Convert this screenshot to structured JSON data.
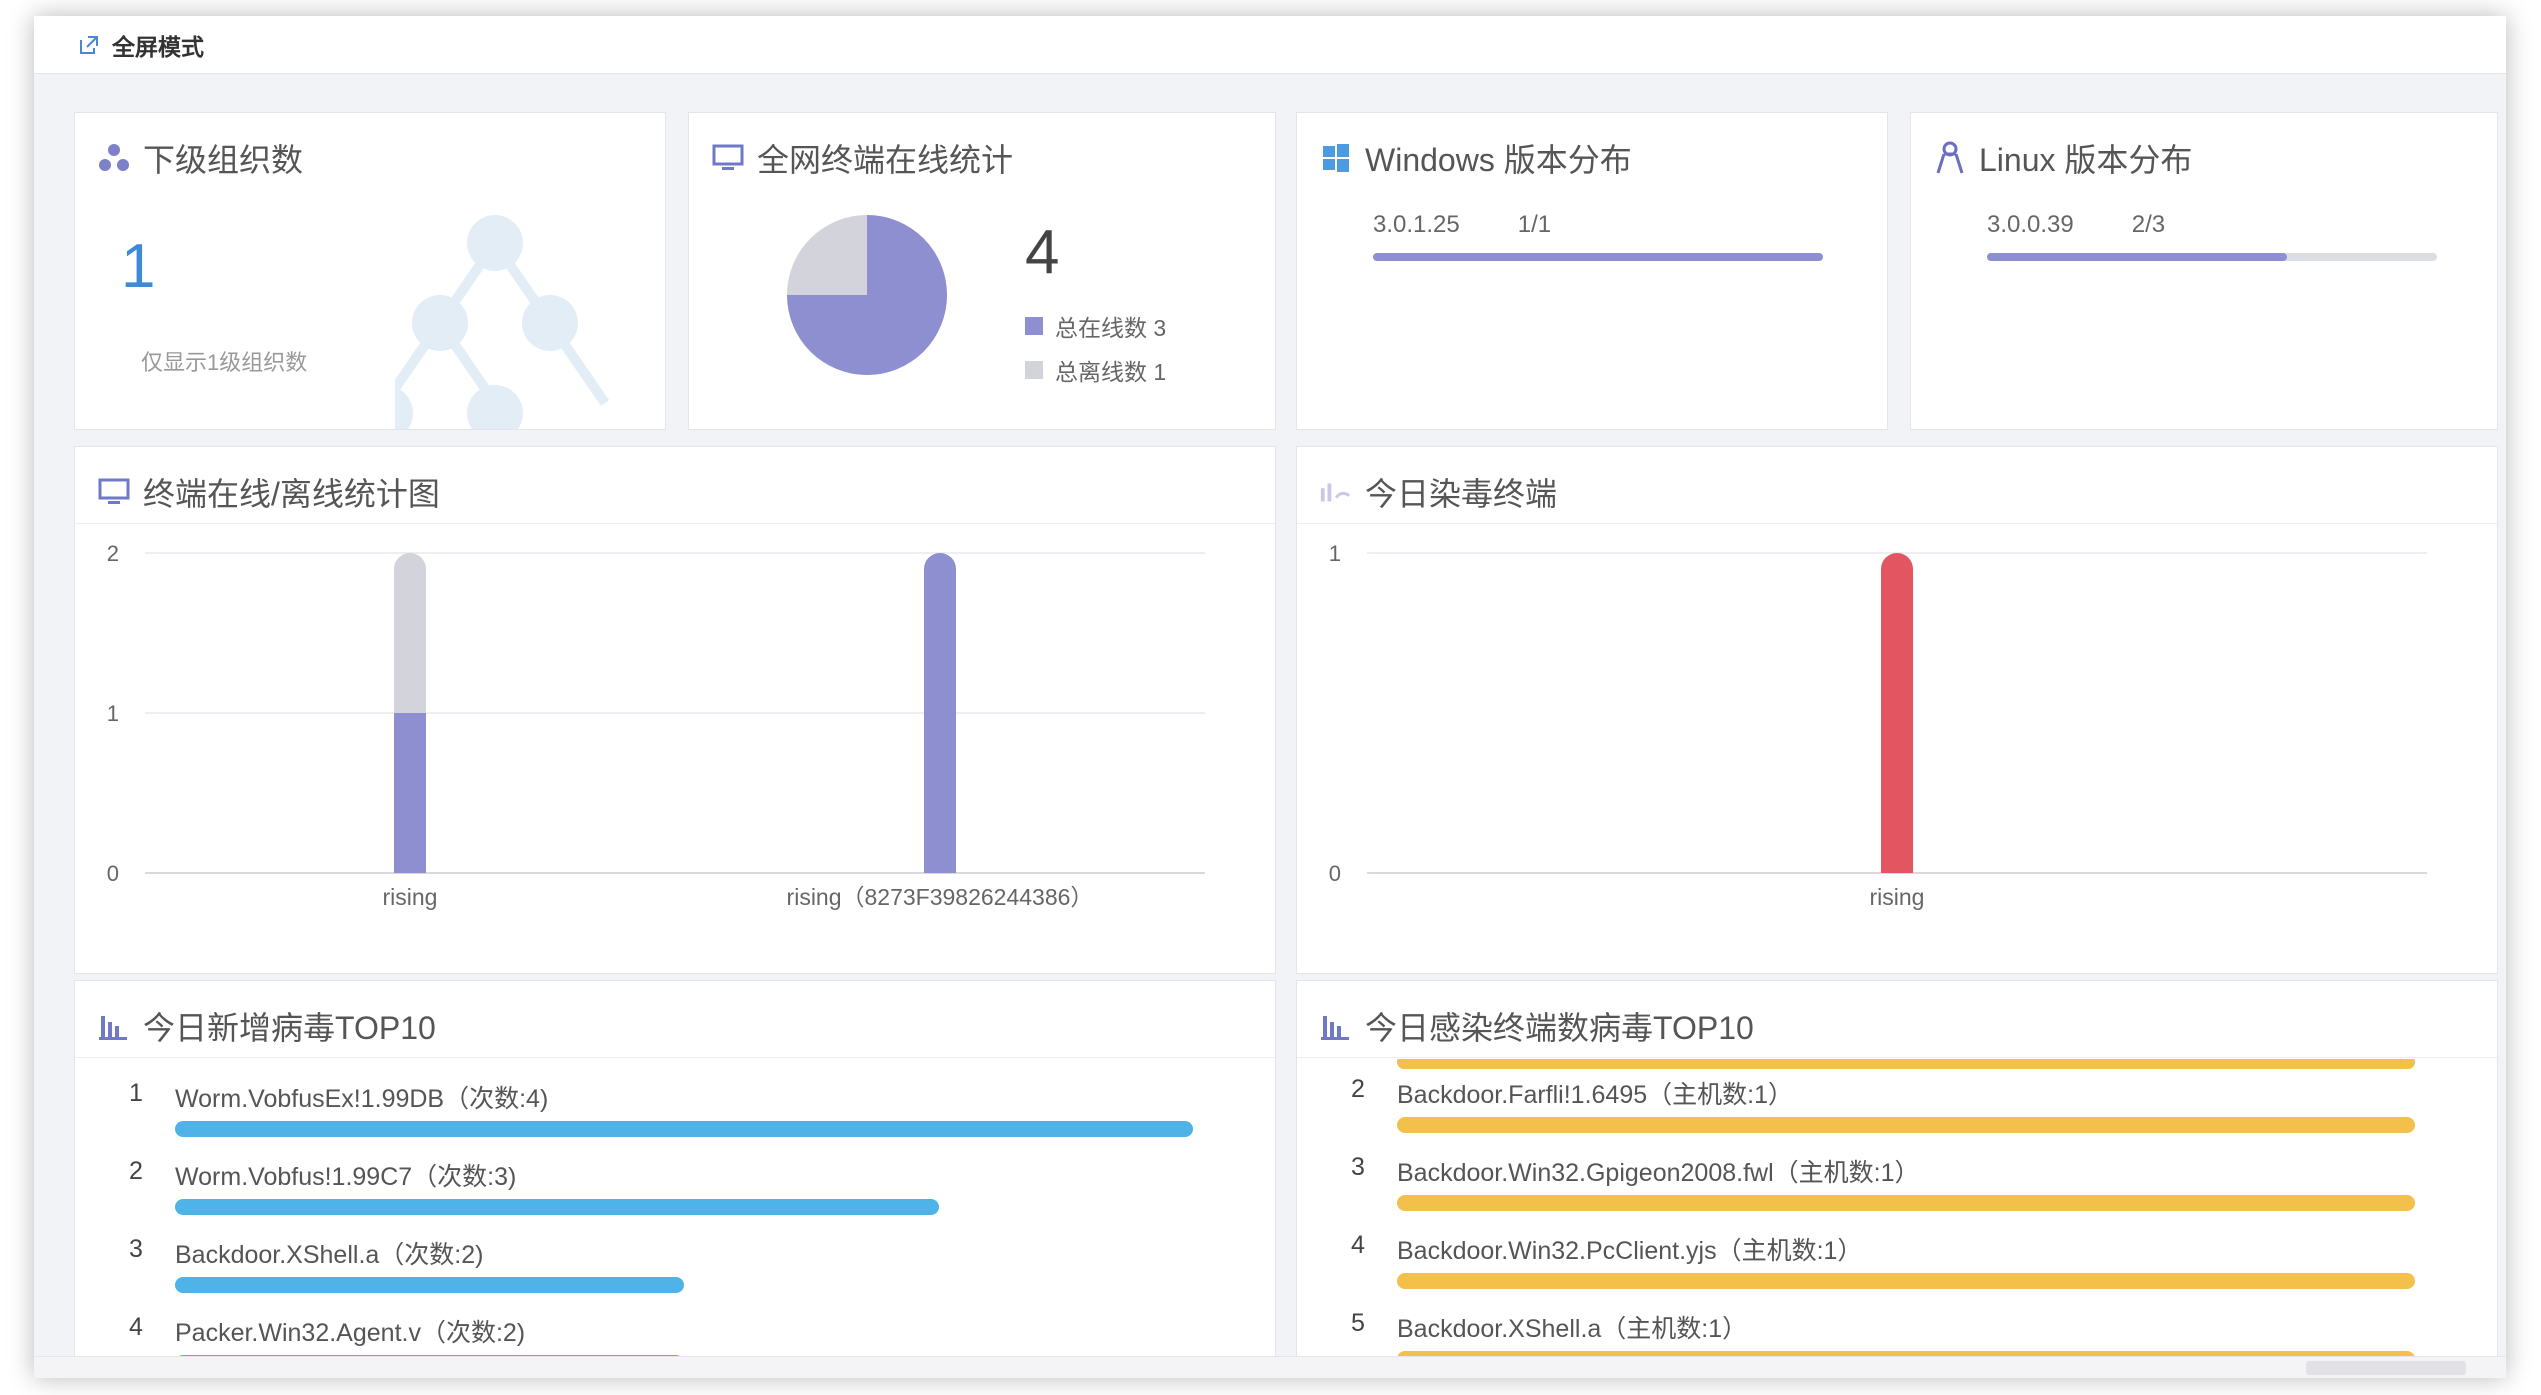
{
  "topbar": {
    "label": "全屏模式"
  },
  "suborg": {
    "title": "下级组织数",
    "count": "1",
    "note": "仅显示1级组织数"
  },
  "online": {
    "title": "全网终端在线统计",
    "total": "4",
    "online_label": "总在线数 3",
    "offline_label": "总离线数 1",
    "online_value": 3,
    "offline_value": 1,
    "colors": {
      "online": "#8d8fd0",
      "offline": "#d3d3dc"
    }
  },
  "windows": {
    "title": "Windows 版本分布",
    "version": "3.0.1.25",
    "ratio": "1/1",
    "fraction": 1.0
  },
  "linux": {
    "title": "Linux 版本分布",
    "version": "3.0.0.39",
    "ratio": "2/3",
    "fraction": 0.667
  },
  "term_chart": {
    "title": "终端在线/离线统计图"
  },
  "infect_chart": {
    "title": "今日染毒终端"
  },
  "chart_data": [
    {
      "type": "bar",
      "title": "终端在线/离线统计图",
      "categories": [
        "rising",
        "rising（8273F39826244386）"
      ],
      "series": [
        {
          "values": [
            1,
            2
          ],
          "color": "#8d8fd0"
        },
        {
          "values": [
            1,
            0
          ],
          "color": "#d3d3dc"
        }
      ],
      "stacked": true,
      "yticks": [
        "0",
        "1",
        "2"
      ],
      "ylim": [
        0,
        2
      ],
      "grid": true
    },
    {
      "type": "bar",
      "title": "今日染毒终端",
      "categories": [
        "rising"
      ],
      "series": [
        {
          "values": [
            1
          ],
          "color": "#e25561"
        }
      ],
      "yticks": [
        "0",
        "1"
      ],
      "ylim": [
        0,
        1
      ],
      "grid": true
    }
  ],
  "new_virus": {
    "title": "今日新增病毒TOP10",
    "color": "#4fb3e8",
    "items": [
      {
        "rank": "1",
        "name": "Worm.VobfusEx!1.99DB（次数:4)",
        "value": 4
      },
      {
        "rank": "2",
        "name": "Worm.Vobfus!1.99C7（次数:3)",
        "value": 3
      },
      {
        "rank": "3",
        "name": "Backdoor.XShell.a（次数:2)",
        "value": 2
      },
      {
        "rank": "4",
        "name": "Packer.Win32.Agent.v（次数:2)",
        "value": 2
      }
    ],
    "max": 4
  },
  "infected_terms": {
    "title": "今日感染终端数病毒TOP10",
    "color": "#f2c04b",
    "items": [
      {
        "rank": "2",
        "name": "Backdoor.Farfli!1.6495（主机数:1）"
      },
      {
        "rank": "3",
        "name": "Backdoor.Win32.Gpigeon2008.fwl（主机数:1）"
      },
      {
        "rank": "4",
        "name": "Backdoor.Win32.PcClient.yjs（主机数:1）"
      },
      {
        "rank": "5",
        "name": "Backdoor.XShell.a（主机数:1）"
      }
    ]
  }
}
